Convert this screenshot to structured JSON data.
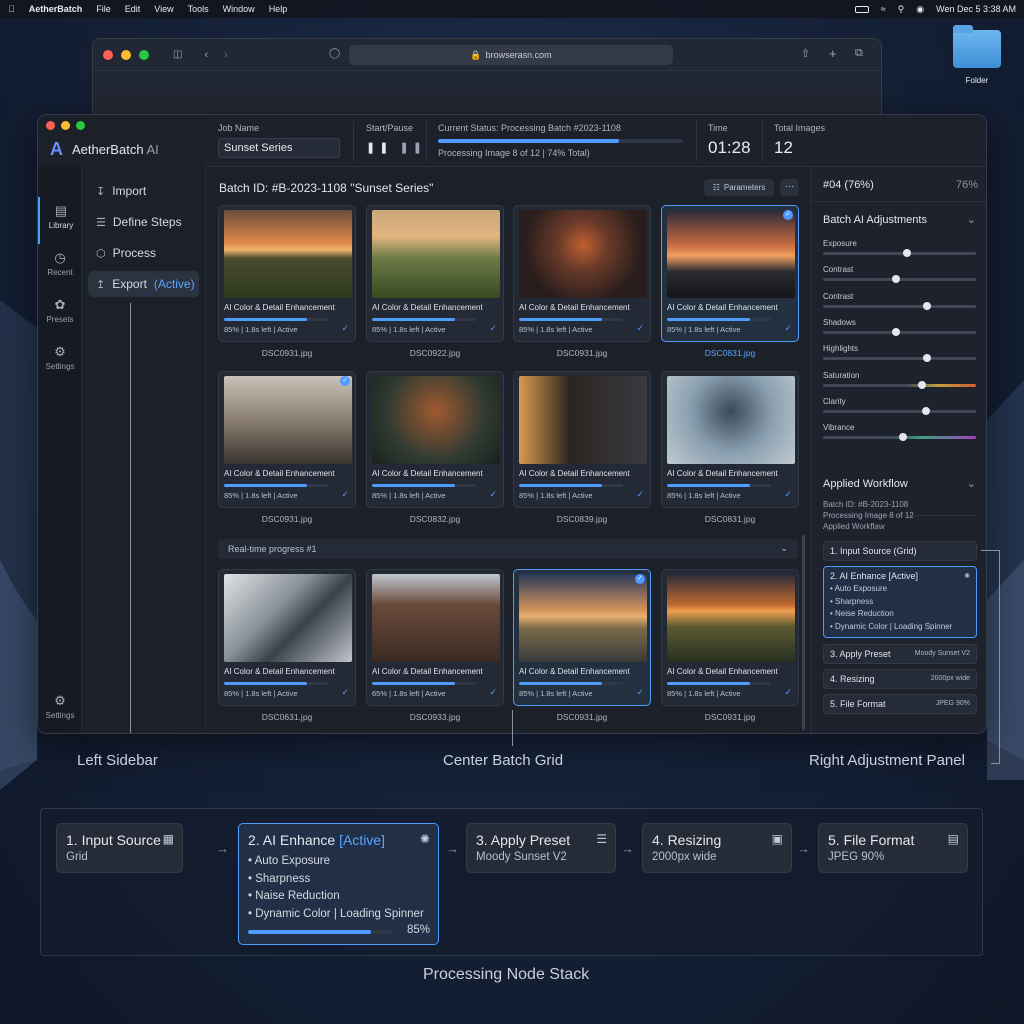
{
  "menubar": {
    "app": "AetherBatch",
    "items": [
      "File",
      "Edit",
      "View",
      "Tools",
      "Window",
      "Help"
    ],
    "clock": "Wen Dec 5 3:38 AM"
  },
  "desktop": {
    "folder_label": "Folder"
  },
  "browser": {
    "url": "browserasn.com"
  },
  "app": {
    "brand": "AetherBatch",
    "brand_suffix": "AI"
  },
  "iconbar": [
    {
      "label": "Library",
      "icon": "library-icon"
    },
    {
      "label": "Recent",
      "icon": "clock-icon"
    },
    {
      "label": "Presets",
      "icon": "presets-icon"
    },
    {
      "label": "Settings",
      "icon": "gear-icon"
    }
  ],
  "iconbar_bottom": {
    "label": "Settings"
  },
  "nav": {
    "import": "Import",
    "define": "Define Steps",
    "process": "Process",
    "export": "Export",
    "export_state": "(Active)"
  },
  "topbar": {
    "job_label": "Job Name",
    "job_value": "Sunset Series",
    "start_label": "Start/Pause",
    "status_label": "Current Status: Processing Batch #2023-1108",
    "status_sub": "Processing Image 8 of 12 | 74% Total)",
    "status_progress": 0.74,
    "time_label": "Time",
    "time_value": "01:28",
    "total_label": "Total Images",
    "total_value": "12"
  },
  "batch": {
    "title": "Batch ID: #B-2023-1108 \"Sunset Series\"",
    "params": "Parameters",
    "more": "···",
    "realtime": "Real-time progress #1"
  },
  "cards": [
    {
      "cap": "AI Color & Detail Enhancement",
      "meta": "85% | 1.8s left | Active",
      "file": "DSC0931.jpg",
      "progress": 0.8
    },
    {
      "cap": "AI Color & Detail Enhancement",
      "meta": "85% | 1.8s left | Active",
      "file": "DSC0922.jpg",
      "progress": 0.8
    },
    {
      "cap": "AI Color & Detail Enhancement",
      "meta": "85% | 1.8s left | Active",
      "file": "DSC0931.jpg",
      "progress": 0.8
    },
    {
      "cap": "AI Color & Detail Enhancement",
      "meta": "85% | 1.8s left | Active",
      "file": "DSC0831.jpg",
      "progress": 0.8
    },
    {
      "cap": "AI Color & Detail Enhancement",
      "meta": "85% | 1.8s left | Active",
      "file": "DSC0931.jpg",
      "progress": 0.8
    },
    {
      "cap": "AI Color & Detail Enhancement",
      "meta": "85% | 1.8s left | Active",
      "file": "DSC0832.jpg",
      "progress": 0.8
    },
    {
      "cap": "AI Color & Detail Enhancement",
      "meta": "85% | 1.8s left | Active",
      "file": "DSC0839.jpg",
      "progress": 0.8
    },
    {
      "cap": "AI Color & Detail Enhancement",
      "meta": "85% | 1.8s left | Active",
      "file": "DSC0831.jpg",
      "progress": 0.8
    },
    {
      "cap": "AI Color & Detail Enhancement",
      "meta": "85% | 1.8s left | Active",
      "file": "DSC0631.jpg",
      "progress": 0.8
    },
    {
      "cap": "AI Color & Detail Enhancement",
      "meta": "65% | 1.8s left | Active",
      "file": "DSC0933.jpg",
      "progress": 0.8
    },
    {
      "cap": "AI Color & Detail Enhancement",
      "meta": "85% | 1.8s left | Active",
      "file": "DSC0931.jpg",
      "progress": 0.8
    },
    {
      "cap": "AI Color & Detail Enhancement",
      "meta": "85% | 1.8s left | Active",
      "file": "DSC0931.jpg",
      "progress": 0.8
    }
  ],
  "right": {
    "header": "#04 (76%)",
    "header_pct": "76%",
    "adj_title": "Batch AI Adjustments",
    "sliders": [
      {
        "label": "Exposure",
        "value": 0.55
      },
      {
        "label": "Contrast",
        "value": 0.48
      },
      {
        "label": "Contrast",
        "value": 0.68
      },
      {
        "label": "Shadows",
        "value": 0.48
      },
      {
        "label": "Highlights",
        "value": 0.68
      },
      {
        "label": "Saturation",
        "value": 0.65
      },
      {
        "label": "Clarity",
        "value": 0.67
      },
      {
        "label": "Vibrance",
        "value": 0.52
      }
    ],
    "wf_title": "Applied Workflow",
    "wf_info": [
      "Batch ID: #B-2023-1108",
      "Processing Image 8 of 12",
      "Applied Workflaw"
    ],
    "wf1": "1. Input Source (Grid)",
    "wf2": "2. AI Enhance [Active]",
    "wf2_items": [
      "Auto Exposure",
      "Sharpness",
      "Neise Reduction",
      "Dynamic Color | Loading Spinner"
    ],
    "wf3": "3. Apply Preset",
    "wf3_r": "Moody Sunset V2",
    "wf4": "4. Resizing",
    "wf4_r": "2000px wide",
    "wf5": "5. File Format",
    "wf5_r": "JPEG 90%"
  },
  "annotations": {
    "left": "Left Sidebar",
    "center": "Center Batch Grid",
    "right": "Right Adjustment Panel",
    "stack": "Processing Node Stack"
  },
  "stack": {
    "n1_t": "1. Input Source",
    "n1_s": "Grid",
    "n2_t": "2. AI Enhance",
    "n2_a": "[Active]",
    "n2_items": [
      "Auto Exposure",
      "Sharpness",
      "Naise Reduction",
      "Dynamic Color | Loading Spinner"
    ],
    "n2_pct": "85%",
    "n2_progress": 0.85,
    "n3_t": "3. Apply Preset",
    "n3_s": "Moody Sunset V2",
    "n4_t": "4. Resizing",
    "n4_s": "2000px wide",
    "n5_t": "5. File Format",
    "n5_s": "JPEG 90%"
  }
}
